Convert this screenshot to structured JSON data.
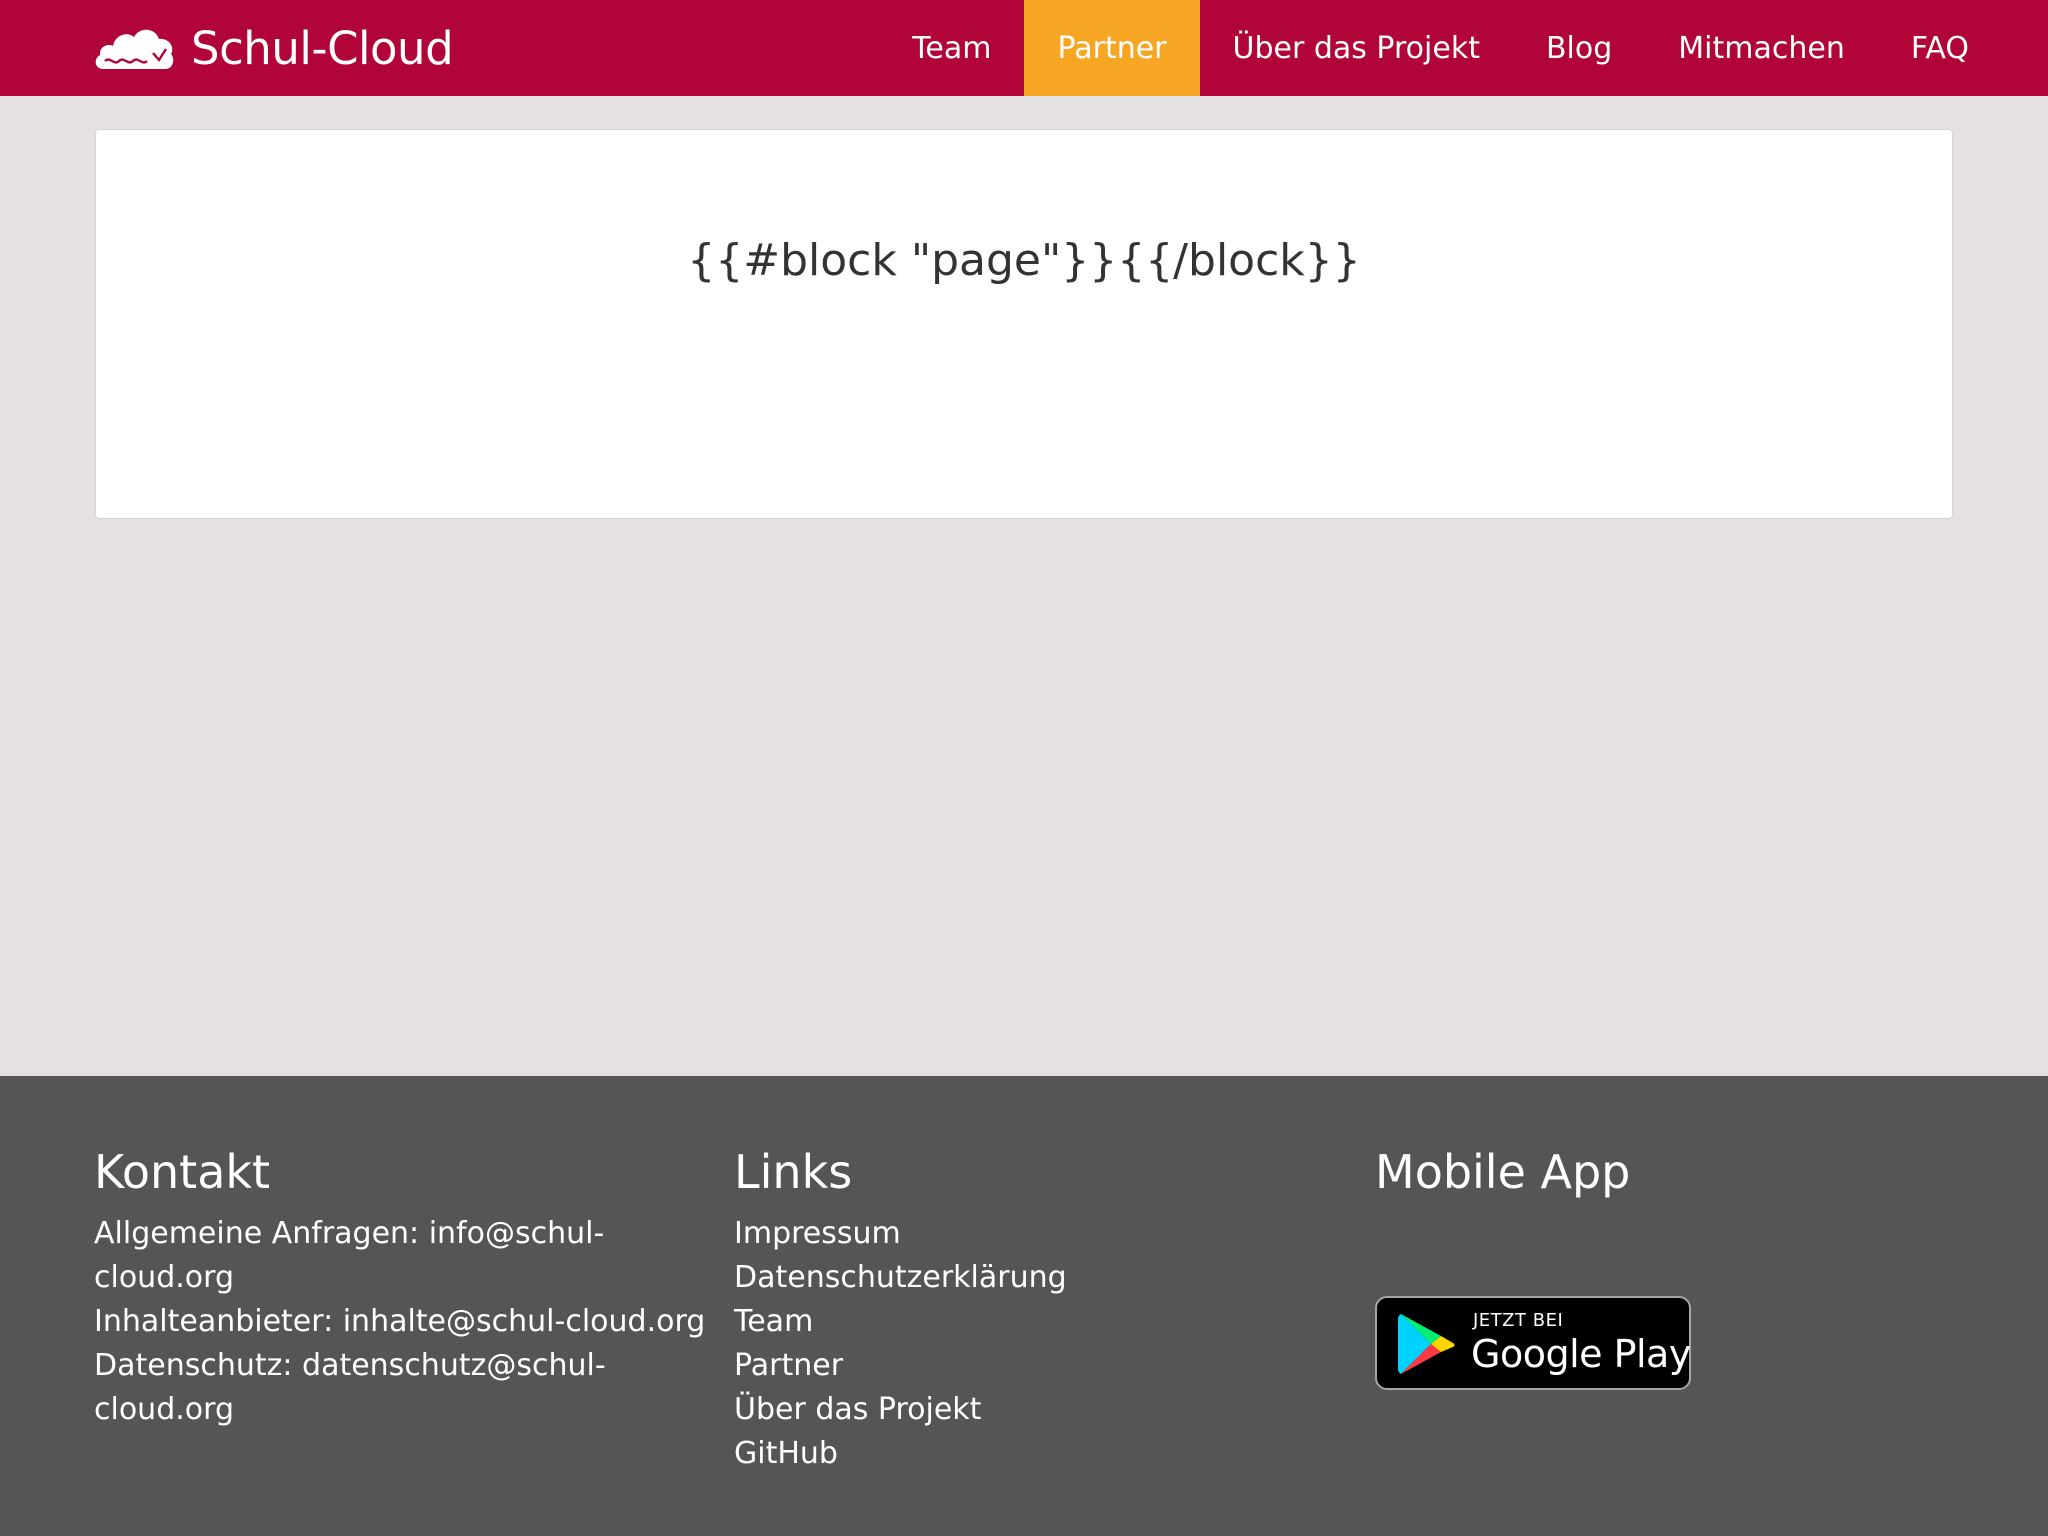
{
  "header": {
    "brand_name": "Schul-Cloud",
    "brand_color": "#b10438",
    "logo_icon": "cloud-icon",
    "nav": [
      {
        "label": "Team",
        "active": false
      },
      {
        "label": "Partner",
        "active": true
      },
      {
        "label": "Über das Projekt",
        "active": false
      },
      {
        "label": "Blog",
        "active": false
      },
      {
        "label": "Mitmachen",
        "active": false
      },
      {
        "label": "FAQ",
        "active": false
      }
    ],
    "active_color": "#f6a623"
  },
  "main": {
    "card_text": "{{#block \"page\"}}{{/block}}"
  },
  "footer": {
    "background": "#555555",
    "kontakt": {
      "heading": "Kontakt",
      "lines": [
        "Allgemeine Anfragen: info@schul-",
        "cloud.org",
        "Inhalteanbieter: inhalte@schul-cloud.org",
        "Datenschutz: datenschutz@schul-",
        "cloud.org"
      ]
    },
    "links": {
      "heading": "Links",
      "items": [
        "Impressum",
        "Datenschutzerklärung",
        "Team",
        "Partner",
        "Über das Projekt",
        "GitHub"
      ]
    },
    "mobile_app": {
      "heading": "Mobile App",
      "badge_small": "JETZT BEI",
      "badge_big": "Google Play",
      "badge_icon": "google-play-icon"
    }
  }
}
